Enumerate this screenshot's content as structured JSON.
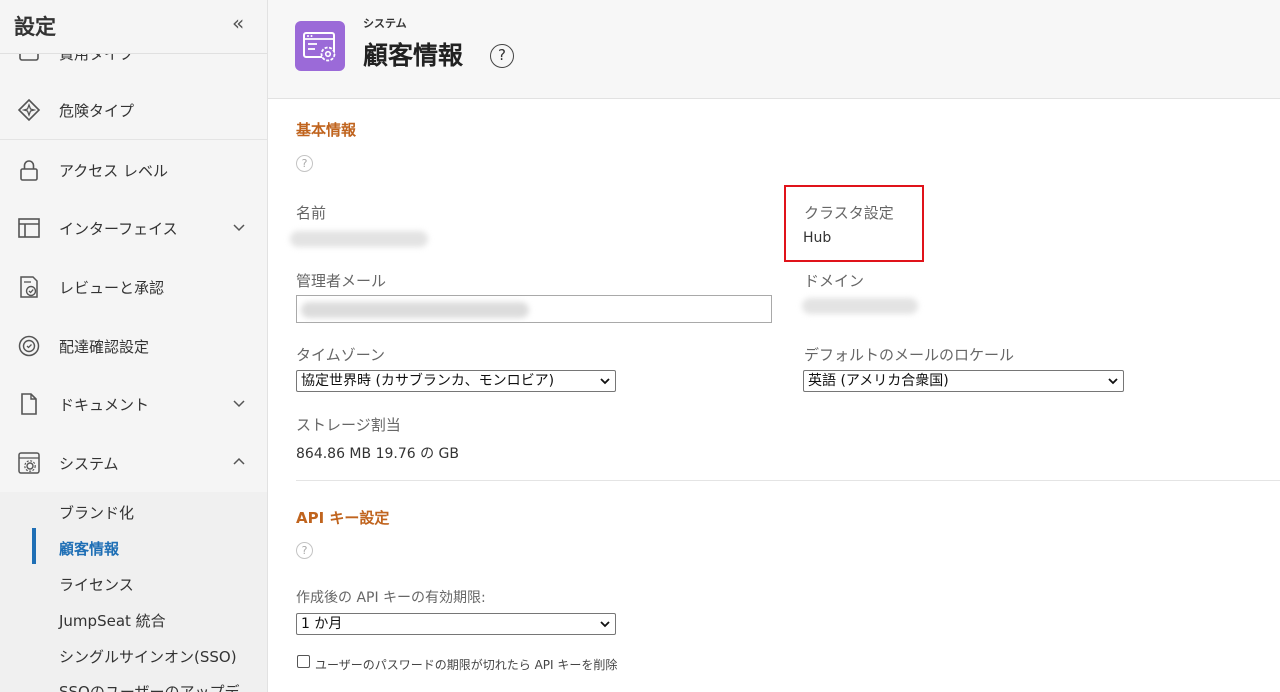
{
  "sidebar": {
    "title": "設定",
    "collapse_icon": "double-chevron-left-icon",
    "partial_item_label": "費用タイプ",
    "items": [
      {
        "label": "危険タイプ",
        "icon": "hazard-icon"
      },
      {
        "label": "アクセス レベル",
        "icon": "lock-icon"
      },
      {
        "label": "インターフェイス",
        "icon": "layout-icon",
        "chevron": "down"
      },
      {
        "label": "レビューと承認",
        "icon": "review-icon"
      },
      {
        "label": "配達確認設定",
        "icon": "delivery-icon"
      },
      {
        "label": "ドキュメント",
        "icon": "document-icon",
        "chevron": "down"
      },
      {
        "label": "システム",
        "icon": "system-icon",
        "chevron": "up"
      }
    ],
    "sub_items": [
      {
        "label": "ブランド化"
      },
      {
        "label": "顧客情報",
        "active": true
      },
      {
        "label": "ライセンス"
      },
      {
        "label": "JumpSeat 統合"
      },
      {
        "label": "シングルサインオン(SSO)"
      },
      {
        "label": "SSOのユーザーのアップデ"
      }
    ]
  },
  "header": {
    "supertitle": "システム",
    "title": "顧客情報",
    "help_glyph": "?"
  },
  "basic_info": {
    "section_title": "基本情報",
    "help_glyph": "?",
    "name_label": "名前",
    "cluster_label": "クラスタ設定",
    "cluster_value": "Hub",
    "admin_email_label": "管理者メール",
    "domain_label": "ドメイン",
    "timezone_label": "タイムゾーン",
    "timezone_value": "協定世界時 (カサブランカ、モンロビア)",
    "locale_label": "デフォルトのメールのロケール",
    "locale_value": "英語 (アメリカ合衆国)",
    "storage_label": "ストレージ割当",
    "storage_value": "864.86 MB  19.76 の GB"
  },
  "api_settings": {
    "section_title": "API キー設定",
    "help_glyph": "?",
    "expiry_label": "作成後の API キーの有効期限:",
    "expiry_value": "1 か月",
    "delete_checkbox_label": "ユーザーのパスワードの期限が切れたら API キーを削除",
    "delete_checked": false
  },
  "colors": {
    "accent": "#c0641e",
    "active": "#1f6fb5",
    "highlight": "#e0131a",
    "page_icon_bg": "#9b6ad8"
  }
}
